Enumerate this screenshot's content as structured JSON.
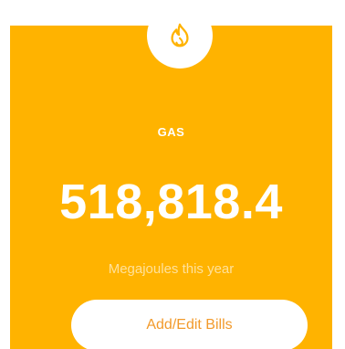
{
  "card": {
    "category": "GAS",
    "value": "518,818.4",
    "unit_text": "Megajoules this year",
    "icon": "flame-icon",
    "button_label": "Add/Edit Bills"
  },
  "colors": {
    "card_background": "#FFB300",
    "icon_stroke": "#FFB300",
    "button_text": "#F29A2B",
    "unit_text": "#FFE19A"
  }
}
